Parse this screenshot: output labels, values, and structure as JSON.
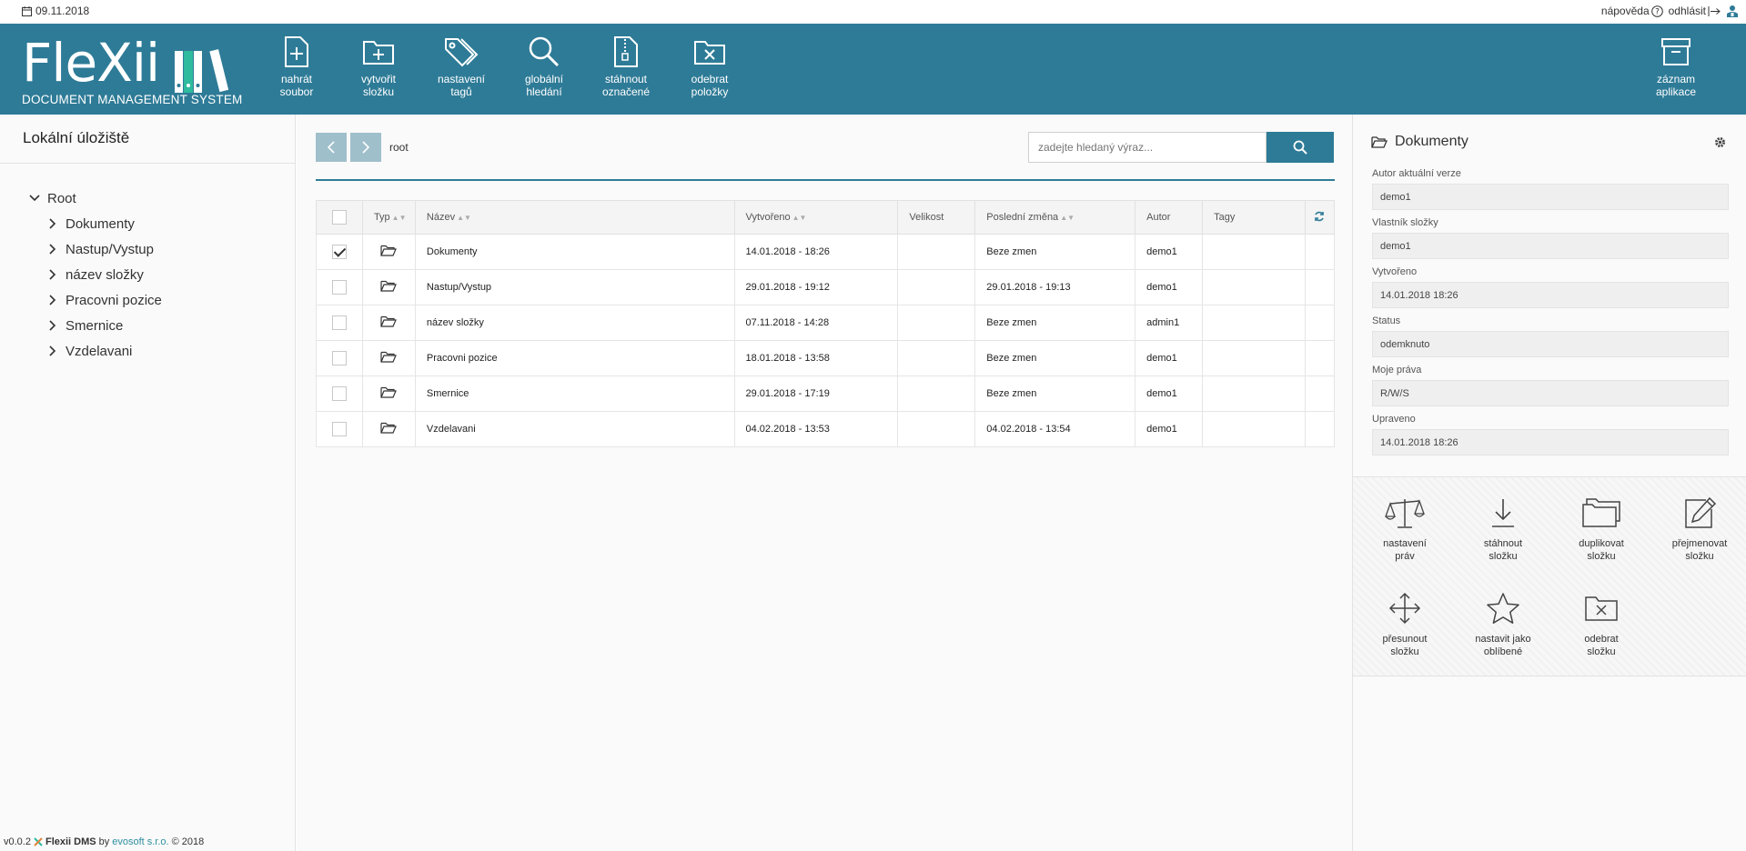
{
  "topbar": {
    "date": "09.11.2018",
    "help_label": "nápověda",
    "logout_label": "odhlásit"
  },
  "brand": {
    "name": "FleXii",
    "subtitle": "DOCUMENT MANAGEMENT SYSTEM"
  },
  "toolbar": [
    {
      "label": "nahrát\nsoubor",
      "icon": "file-plus-icon"
    },
    {
      "label": "vytvořit\nsložku",
      "icon": "folder-plus-icon"
    },
    {
      "label": "nastavení\ntagů",
      "icon": "tags-icon"
    },
    {
      "label": "globální\nhledání",
      "icon": "search-icon"
    },
    {
      "label": "stáhnout\noznačené",
      "icon": "zip-file-icon"
    },
    {
      "label": "odebrat\npoložky",
      "icon": "folder-remove-icon"
    },
    {
      "label": "záznam\naplikace",
      "icon": "archive-icon"
    }
  ],
  "sidebar": {
    "title": "Lokální úložiště",
    "root": "Root",
    "items": [
      "Dokumenty",
      "Nastup/Vystup",
      "název složky",
      "Pracovni pozice",
      "Smernice",
      "Vzdelavani"
    ]
  },
  "footer": {
    "version": "v0.0.2",
    "product": "Flexii DMS",
    "by": "by",
    "company": "evosoft s.r.o.",
    "copyright": "© 2018"
  },
  "main": {
    "breadcrumb": "root",
    "search_placeholder": "zadejte hledaný výraz...",
    "columns": {
      "type": "Typ",
      "name": "Název",
      "created": "Vytvořeno",
      "size": "Velikost",
      "modified": "Poslední změna",
      "author": "Autor",
      "tags": "Tagy"
    },
    "rows": [
      {
        "checked": true,
        "name": "Dokumenty",
        "created": "14.01.2018 - 18:26",
        "size": "",
        "modified": "Beze zmen",
        "author": "demo1",
        "tags": ""
      },
      {
        "checked": false,
        "name": "Nastup/Vystup",
        "created": "29.01.2018 - 19:12",
        "size": "",
        "modified": "29.01.2018 - 19:13",
        "author": "demo1",
        "tags": ""
      },
      {
        "checked": false,
        "name": "název složky",
        "created": "07.11.2018 - 14:28",
        "size": "",
        "modified": "Beze zmen",
        "author": "admin1",
        "tags": ""
      },
      {
        "checked": false,
        "name": "Pracovni pozice",
        "created": "18.01.2018 - 13:58",
        "size": "",
        "modified": "Beze zmen",
        "author": "demo1",
        "tags": ""
      },
      {
        "checked": false,
        "name": "Smernice",
        "created": "29.01.2018 - 17:19",
        "size": "",
        "modified": "Beze zmen",
        "author": "demo1",
        "tags": ""
      },
      {
        "checked": false,
        "name": "Vzdelavani",
        "created": "04.02.2018 - 13:53",
        "size": "",
        "modified": "04.02.2018 - 13:54",
        "author": "demo1",
        "tags": ""
      }
    ]
  },
  "detail": {
    "title": "Dokumenty",
    "properties": [
      {
        "label": "Autor aktuální verze",
        "value": "demo1"
      },
      {
        "label": "Vlastník složky",
        "value": "demo1"
      },
      {
        "label": "Vytvořeno",
        "value": "14.01.2018 18:26"
      },
      {
        "label": "Status",
        "value": "odemknuto"
      },
      {
        "label": "Moje práva",
        "value": "R/W/S"
      },
      {
        "label": "Upraveno",
        "value": "14.01.2018 18:26"
      }
    ],
    "actions": [
      {
        "label": "nastavení\npráv",
        "icon": "scales-icon"
      },
      {
        "label": "stáhnout\nsložku",
        "icon": "download-icon"
      },
      {
        "label": "duplikovat\nsložku",
        "icon": "duplicate-folder-icon"
      },
      {
        "label": "přejmenovat\nsložku",
        "icon": "edit-icon"
      },
      {
        "label": "přesunout\nsložku",
        "icon": "move-icon"
      },
      {
        "label": "nastavit jako\noblíbené",
        "icon": "star-icon"
      },
      {
        "label": "odebrat\nsložku",
        "icon": "folder-remove-icon"
      }
    ]
  },
  "colors": {
    "header": "#2e7b97",
    "nav_button": "#9fbfcb",
    "link": "#2e8f9f"
  }
}
